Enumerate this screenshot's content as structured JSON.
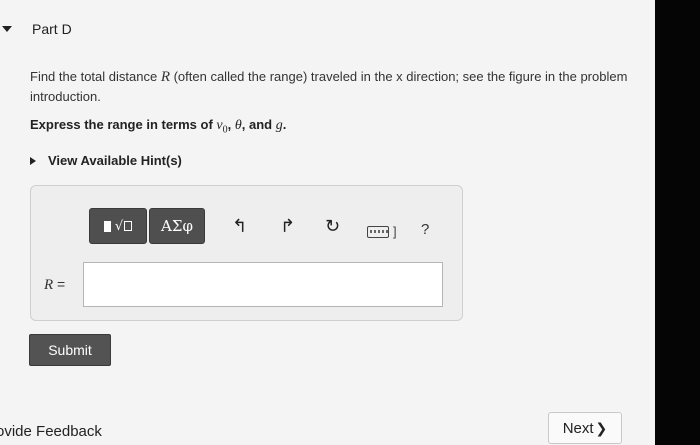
{
  "part": {
    "title": "Part D"
  },
  "problem": {
    "text_before": "Find the total distance ",
    "variable": "R",
    "text_after": " (often called the range) traveled in the x direction; see the figure in the problem introduction."
  },
  "instruction": {
    "lead": "Express the range in terms of ",
    "v0": "v",
    "v0_sub": "0",
    "sep1": ", ",
    "theta": "θ",
    "sep2": ", and ",
    "g": "g",
    "end": "."
  },
  "hints": {
    "label": "View Available Hint(s)"
  },
  "toolbar": {
    "templates_sqrt_glyph": "√",
    "greek_label": "ΑΣφ",
    "undo_glyph": "↰",
    "redo_glyph": "↱",
    "reset_glyph": "↻",
    "keyboard_suffix": "]",
    "help_glyph": "?",
    "icons": [
      "templates-icon",
      "greek-icon",
      "undo-icon",
      "redo-icon",
      "reset-icon",
      "keyboard-icon",
      "help-icon"
    ]
  },
  "answer": {
    "var": "R",
    "eq": " =",
    "value": "",
    "placeholder": ""
  },
  "submit": {
    "label": "Submit"
  },
  "footer": {
    "feedback_label": "ovide Feedback",
    "next_label": "Next",
    "next_chevron": "❯"
  }
}
